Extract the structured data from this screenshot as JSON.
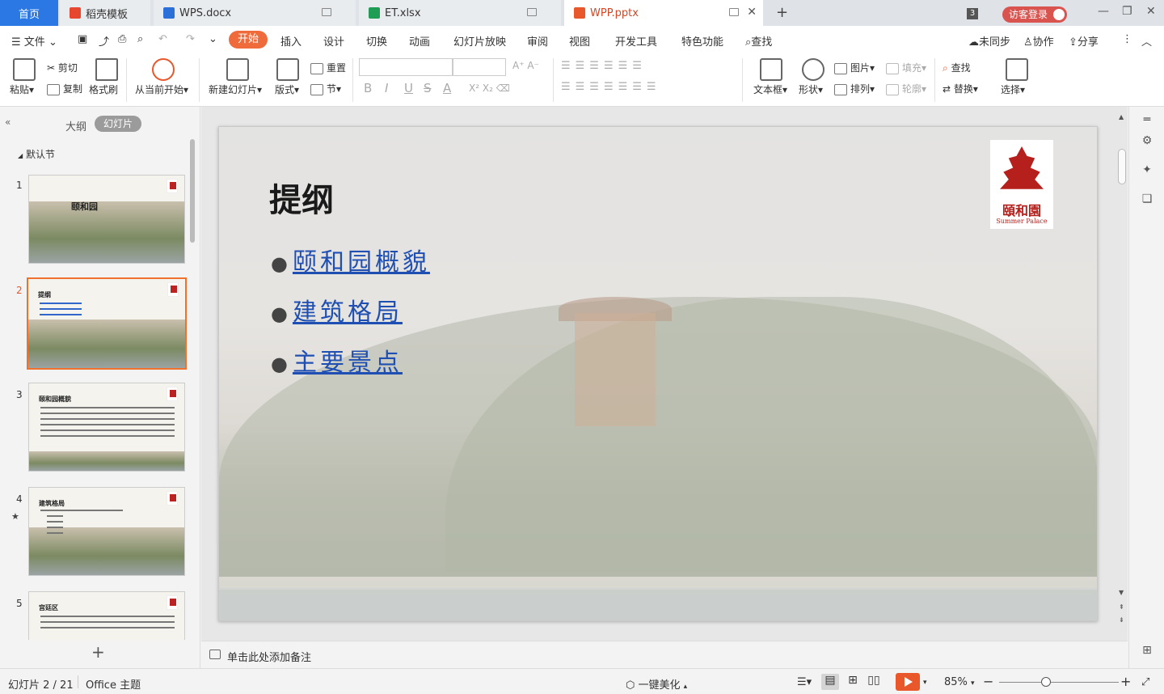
{
  "tabs": {
    "home": "首页",
    "template": "稻壳模板",
    "doc": "WPS.docx",
    "sheet": "ET.xlsx",
    "ppt": "WPP.pptx",
    "count": "3",
    "login": "访客登录"
  },
  "menu": {
    "file": "文件",
    "items": [
      "开始",
      "插入",
      "设计",
      "切换",
      "动画",
      "幻灯片放映",
      "审阅",
      "视图",
      "开发工具",
      "特色功能"
    ],
    "search": "查找",
    "sync": "未同步",
    "collab": "协作",
    "share": "分享"
  },
  "ribbon": {
    "paste": "粘贴",
    "cut": "剪切",
    "copy": "复制",
    "format_painter": "格式刷",
    "from_current": "从当前开始",
    "new_slide": "新建幻灯片",
    "layout": "版式",
    "reset": "重置",
    "section": "节",
    "textbox": "文本框",
    "shape": "形状",
    "picture": "图片",
    "arrange": "排列",
    "fill": "填充",
    "outline": "轮廓",
    "find": "查找",
    "replace": "替换",
    "select": "选择",
    "font_bold": "B",
    "font_italic": "I",
    "font_underline": "U",
    "font_strike": "S",
    "font_color": "A"
  },
  "leftpanel": {
    "outline": "大纲",
    "slides": "幻灯片",
    "section": "默认节",
    "thumbs": [
      {
        "num": "1",
        "title": "颐和园"
      },
      {
        "num": "2",
        "title": "提纲"
      },
      {
        "num": "3",
        "title": "颐和园概貌"
      },
      {
        "num": "4",
        "title": "建筑格局"
      },
      {
        "num": "5",
        "title": "宫廷区"
      }
    ]
  },
  "slide": {
    "title": "提纲",
    "bullets": [
      "颐和园概貌",
      "建筑格局",
      "主要景点"
    ],
    "logo_cn": "頤和園",
    "logo_en": "Summer Palace"
  },
  "notes": "单击此处添加备注",
  "status": {
    "slide_count": "幻灯片 2 / 21",
    "theme": "Office 主题",
    "beautify": "一键美化",
    "zoom": "85%"
  },
  "colors": {
    "accent": "#ef6b3b",
    "home_tab": "#2b78e4",
    "link": "#1f4fb3"
  }
}
